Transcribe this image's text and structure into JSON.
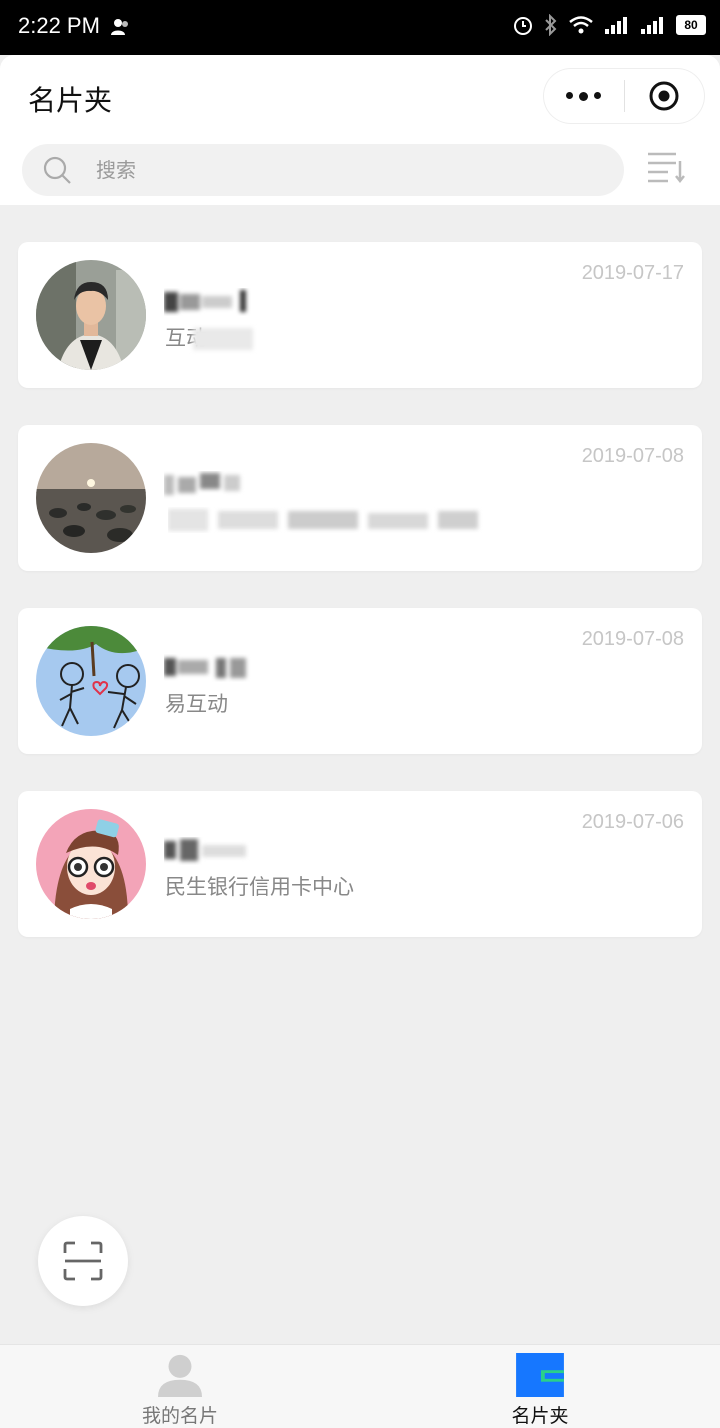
{
  "status_bar": {
    "time": "2:22 PM",
    "battery": "80"
  },
  "header": {
    "title": "名片夹"
  },
  "search": {
    "placeholder": "搜索"
  },
  "cards": [
    {
      "date": "2019-07-17",
      "company": "互动"
    },
    {
      "date": "2019-07-08",
      "company": ""
    },
    {
      "date": "2019-07-08",
      "company": "易互动"
    },
    {
      "date": "2019-07-06",
      "company": "民生银行信用卡中心"
    }
  ],
  "tabbar": {
    "tabs": [
      {
        "label": "我的名片"
      },
      {
        "label": "名片夹"
      }
    ]
  },
  "colors": {
    "accent": "#1677ff",
    "accent_green": "#2ad08a",
    "date_gray": "#c6c6c6"
  }
}
